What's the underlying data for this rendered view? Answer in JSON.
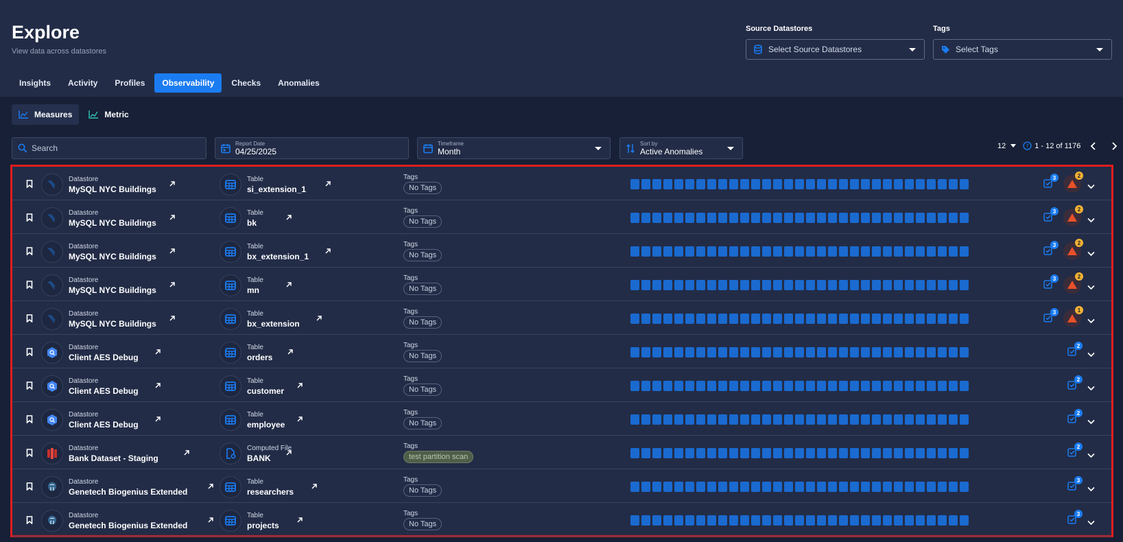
{
  "header": {
    "title": "Explore",
    "subtitle": "View data across datastores",
    "source_label": "Source Datastores",
    "source_placeholder": "Select Source Datastores",
    "tags_label": "Tags",
    "tags_placeholder": "Select Tags"
  },
  "tabs": [
    {
      "label": "Insights",
      "active": false
    },
    {
      "label": "Activity",
      "active": false
    },
    {
      "label": "Profiles",
      "active": false
    },
    {
      "label": "Observability",
      "active": true
    },
    {
      "label": "Checks",
      "active": false
    },
    {
      "label": "Anomalies",
      "active": false
    }
  ],
  "subtabs": [
    {
      "label": "Measures",
      "active": true
    },
    {
      "label": "Metric",
      "active": false
    }
  ],
  "controls": {
    "search_placeholder": "Search",
    "report_date_label": "Report Date",
    "report_date_value": "04/25/2025",
    "timeframe_label": "Timeframe",
    "timeframe_value": "Month",
    "sort_label": "Sort by",
    "sort_value": "Active Anomalies"
  },
  "pager": {
    "page_size": "12",
    "range": "1 - 12 of 1176"
  },
  "colors": {
    "accent": "#1b7cf2",
    "highlight_border": "#e31d1d",
    "anomaly_badge": "#f2b134",
    "check_badge": "#1b7cf2"
  },
  "rows": [
    {
      "ds_label": "Datastore",
      "ds_name": "MySQL NYC Buildings",
      "ds_icon": "mysql-icon",
      "asset_label": "Table",
      "asset_name": "si_extension_1",
      "asset_icon": "table-icon",
      "tags_label": "Tags",
      "tag": "No Tags",
      "tag_style": "empty",
      "checks": "3",
      "anomalies": "2"
    },
    {
      "ds_label": "Datastore",
      "ds_name": "MySQL NYC Buildings",
      "ds_icon": "mysql-icon",
      "asset_label": "Table",
      "asset_name": "bk",
      "asset_icon": "table-icon",
      "tags_label": "Tags",
      "tag": "No Tags",
      "tag_style": "empty",
      "checks": "3",
      "anomalies": "2"
    },
    {
      "ds_label": "Datastore",
      "ds_name": "MySQL NYC Buildings",
      "ds_icon": "mysql-icon",
      "asset_label": "Table",
      "asset_name": "bx_extension_1",
      "asset_icon": "table-icon",
      "tags_label": "Tags",
      "tag": "No Tags",
      "tag_style": "empty",
      "checks": "3",
      "anomalies": "2"
    },
    {
      "ds_label": "Datastore",
      "ds_name": "MySQL NYC Buildings",
      "ds_icon": "mysql-icon",
      "asset_label": "Table",
      "asset_name": "mn",
      "asset_icon": "table-icon",
      "tags_label": "Tags",
      "tag": "No Tags",
      "tag_style": "empty",
      "checks": "3",
      "anomalies": "2"
    },
    {
      "ds_label": "Datastore",
      "ds_name": "MySQL NYC Buildings",
      "ds_icon": "mysql-icon",
      "asset_label": "Table",
      "asset_name": "bx_extension",
      "asset_icon": "table-icon",
      "tags_label": "Tags",
      "tag": "No Tags",
      "tag_style": "empty",
      "checks": "3",
      "anomalies": "1"
    },
    {
      "ds_label": "Datastore",
      "ds_name": "Client AES Debug",
      "ds_icon": "bigquery-icon",
      "asset_label": "Table",
      "asset_name": "orders",
      "asset_icon": "table-icon",
      "tags_label": "Tags",
      "tag": "No Tags",
      "tag_style": "empty",
      "checks": "2",
      "anomalies": ""
    },
    {
      "ds_label": "Datastore",
      "ds_name": "Client AES Debug",
      "ds_icon": "bigquery-icon",
      "asset_label": "Table",
      "asset_name": "customer",
      "asset_icon": "table-icon",
      "tags_label": "Tags",
      "tag": "No Tags",
      "tag_style": "empty",
      "checks": "2",
      "anomalies": ""
    },
    {
      "ds_label": "Datastore",
      "ds_name": "Client AES Debug",
      "ds_icon": "bigquery-icon",
      "asset_label": "Table",
      "asset_name": "employee",
      "asset_icon": "table-icon",
      "tags_label": "Tags",
      "tag": "No Tags",
      "tag_style": "empty",
      "checks": "2",
      "anomalies": ""
    },
    {
      "ds_label": "Datastore",
      "ds_name": "Bank Dataset - Staging",
      "ds_icon": "redshift-icon",
      "asset_label": "Computed File",
      "asset_name": "BANK",
      "asset_icon": "computed-file-icon",
      "tags_label": "Tags",
      "tag": "test partition scan",
      "tag_style": "green",
      "checks": "2",
      "anomalies": ""
    },
    {
      "ds_label": "Datastore",
      "ds_name": "Genetech Biogenius Extended",
      "ds_icon": "postgres-icon",
      "asset_label": "Table",
      "asset_name": "researchers",
      "asset_icon": "table-icon",
      "tags_label": "Tags",
      "tag": "No Tags",
      "tag_style": "empty",
      "checks": "3",
      "anomalies": ""
    },
    {
      "ds_label": "Datastore",
      "ds_name": "Genetech Biogenius Extended",
      "ds_icon": "postgres-icon",
      "asset_label": "Table",
      "asset_name": "projects",
      "asset_icon": "table-icon",
      "tags_label": "Tags",
      "tag": "No Tags",
      "tag_style": "empty",
      "checks": "3",
      "anomalies": ""
    }
  ]
}
